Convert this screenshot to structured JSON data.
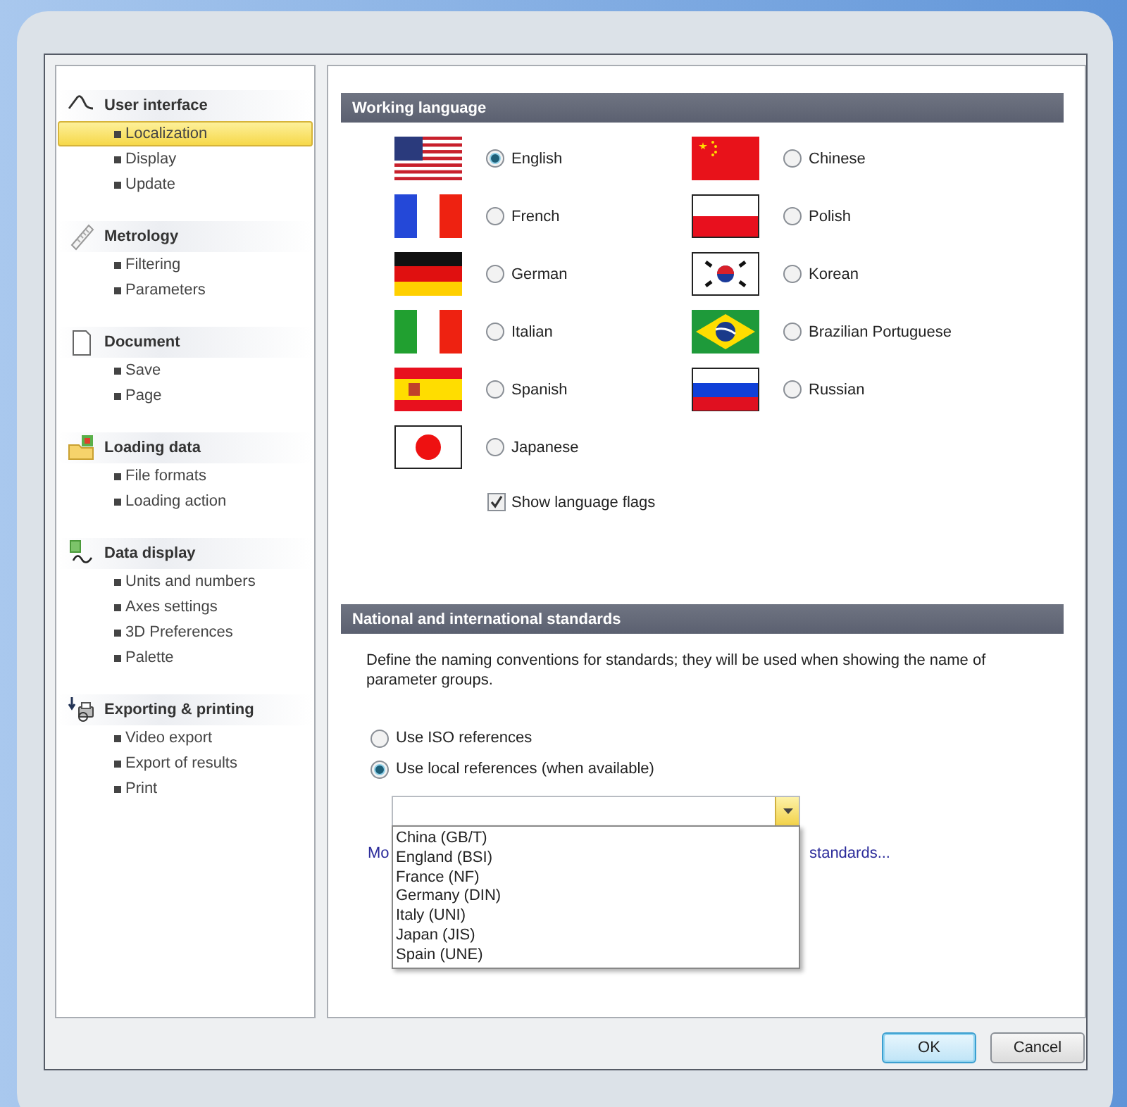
{
  "sidebar": {
    "groups": [
      {
        "title": "User interface",
        "items": [
          {
            "label": "Localization",
            "selected": true
          },
          {
            "label": "Display",
            "selected": false
          },
          {
            "label": "Update",
            "selected": false
          }
        ]
      },
      {
        "title": "Metrology",
        "items": [
          {
            "label": "Filtering",
            "selected": false
          },
          {
            "label": "Parameters",
            "selected": false
          }
        ]
      },
      {
        "title": "Document",
        "items": [
          {
            "label": "Save",
            "selected": false
          },
          {
            "label": "Page",
            "selected": false
          }
        ]
      },
      {
        "title": "Loading data",
        "items": [
          {
            "label": "File formats",
            "selected": false
          },
          {
            "label": "Loading action",
            "selected": false
          }
        ]
      },
      {
        "title": "Data display",
        "items": [
          {
            "label": "Units and numbers",
            "selected": false
          },
          {
            "label": "Axes settings",
            "selected": false
          },
          {
            "label": "3D Preferences",
            "selected": false
          },
          {
            "label": "Palette",
            "selected": false
          }
        ]
      },
      {
        "title": "Exporting & printing",
        "items": [
          {
            "label": "Video export",
            "selected": false
          },
          {
            "label": "Export of results",
            "selected": false
          },
          {
            "label": "Print",
            "selected": false
          }
        ]
      }
    ]
  },
  "working_language": {
    "title": "Working language",
    "languages": [
      {
        "label": "English",
        "selected": true
      },
      {
        "label": "Chinese",
        "selected": false
      },
      {
        "label": "French",
        "selected": false
      },
      {
        "label": "Polish",
        "selected": false
      },
      {
        "label": "German",
        "selected": false
      },
      {
        "label": "Korean",
        "selected": false
      },
      {
        "label": "Italian",
        "selected": false
      },
      {
        "label": "Brazilian Portuguese",
        "selected": false
      },
      {
        "label": "Spanish",
        "selected": false
      },
      {
        "label": "Russian",
        "selected": false
      },
      {
        "label": "Japanese",
        "selected": false
      }
    ],
    "show_flags": {
      "label": "Show language flags",
      "checked": true
    }
  },
  "standards": {
    "title": "National and international standards",
    "description": "Define the naming conventions for standards; they will be used when showing the name of parameter groups.",
    "options": [
      {
        "label": "Use ISO references",
        "selected": false
      },
      {
        "label": "Use local references (when available)",
        "selected": true
      }
    ],
    "dropdown": {
      "expanded": true,
      "options": [
        {
          "label": "China (GB/T)",
          "selected": false
        },
        {
          "label": "England (BSI)",
          "selected": false
        },
        {
          "label": "France (NF)",
          "selected": false
        },
        {
          "label": "Germany (DIN)",
          "selected": false
        },
        {
          "label": "Italy (UNI)",
          "selected": false
        },
        {
          "label": "Japan (JIS)",
          "selected": false
        },
        {
          "label": "Spain (UNE)",
          "selected": false
        }
      ]
    },
    "link_start": "Mo",
    "link_end": "standards..."
  },
  "buttons": [
    {
      "label": "OK",
      "default": true
    },
    {
      "label": "Cancel",
      "default": false
    }
  ]
}
